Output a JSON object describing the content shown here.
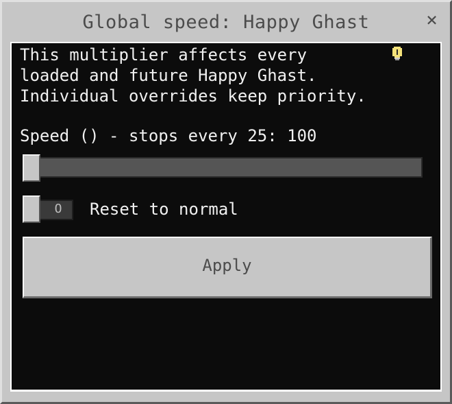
{
  "dialog": {
    "title": "Global speed: Happy Ghast",
    "close_label": "×"
  },
  "description": {
    "lines": [
      "This multiplier affects every",
      "loaded and future Happy Ghast.",
      "Individual overrides keep priority."
    ],
    "hint_icon": "lightbulb-icon"
  },
  "speed": {
    "label": "Speed () - stops every 25: 100",
    "value": 100,
    "step": 25,
    "slider_fraction": 0.0
  },
  "reset": {
    "toggle_state_label": "O",
    "label": "Reset to normal",
    "checked": false
  },
  "apply": {
    "label": "Apply"
  },
  "colors": {
    "frame": "#c6c6c6",
    "content_bg": "#0c0c0c",
    "text": "#f0f0f0",
    "bulb": "#f4e27a"
  }
}
